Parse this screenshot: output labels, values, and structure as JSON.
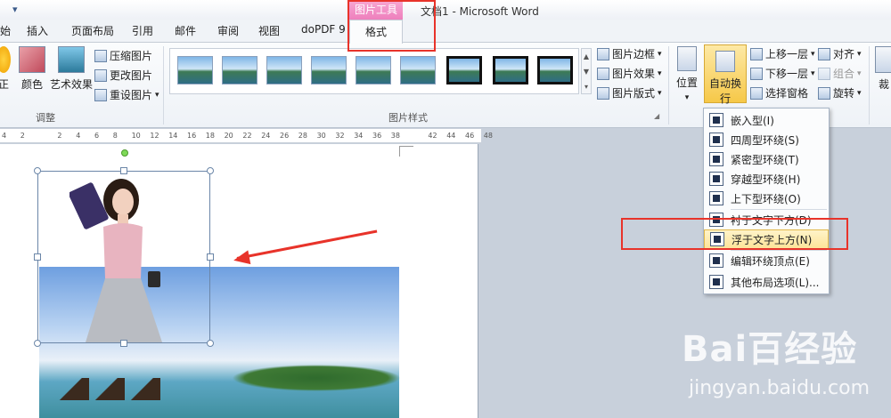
{
  "window": {
    "title": "文档1 - Microsoft Word",
    "context_group": "图片工具",
    "quick_access": "▾"
  },
  "tabs": [
    {
      "label": "始"
    },
    {
      "label": "插入"
    },
    {
      "label": "页面布局"
    },
    {
      "label": "引用"
    },
    {
      "label": "邮件"
    },
    {
      "label": "审阅"
    },
    {
      "label": "视图"
    },
    {
      "label": "doPDF 9"
    },
    {
      "label": "格式",
      "active": true
    }
  ],
  "ribbon": {
    "adjust": {
      "label": "调整",
      "correct": "正",
      "color": "颜色",
      "art_effect": "艺术效果",
      "compress": "压缩图片",
      "change": "更改图片",
      "reset": "重设图片"
    },
    "styles": {
      "label": "图片样式",
      "border": "图片边框",
      "effect": "图片效果",
      "layout": "图片版式",
      "thumb_count": 9
    },
    "arrange": {
      "position": "位置",
      "auto_wrap": "自动换行",
      "bring_forward": "上移一层",
      "send_backward": "下移一层",
      "selection_pane": "选择窗格",
      "align": "对齐",
      "group": "组合",
      "rotate": "旋转",
      "crop": "裁"
    }
  },
  "ruler": {
    "ticks": [
      "4",
      "2",
      "",
      "2",
      "4",
      "6",
      "8",
      "10",
      "12",
      "14",
      "16",
      "18",
      "20",
      "22",
      "24",
      "26",
      "28",
      "30",
      "32",
      "34",
      "36",
      "38",
      "",
      "42",
      "44",
      "46",
      "48"
    ]
  },
  "menu": {
    "items": [
      {
        "label": "嵌入型(I)"
      },
      {
        "label": "四周型环绕(S)"
      },
      {
        "label": "紧密型环绕(T)"
      },
      {
        "label": "穿越型环绕(H)"
      },
      {
        "label": "上下型环绕(O)"
      },
      {
        "label": "衬于文字下方(D)"
      },
      {
        "label": "浮于文字上方(N)",
        "highlighted": true
      },
      {
        "label": "编辑环绕顶点(E)"
      },
      {
        "label": "其他布局选项(L)..."
      }
    ]
  },
  "watermark": {
    "logo": "Bai百经验",
    "url": "jingyan.baidu.com"
  },
  "colors": {
    "accent_red": "#e8332a",
    "highlight": "#fde49a",
    "context_pink": "#ee7fbd"
  }
}
